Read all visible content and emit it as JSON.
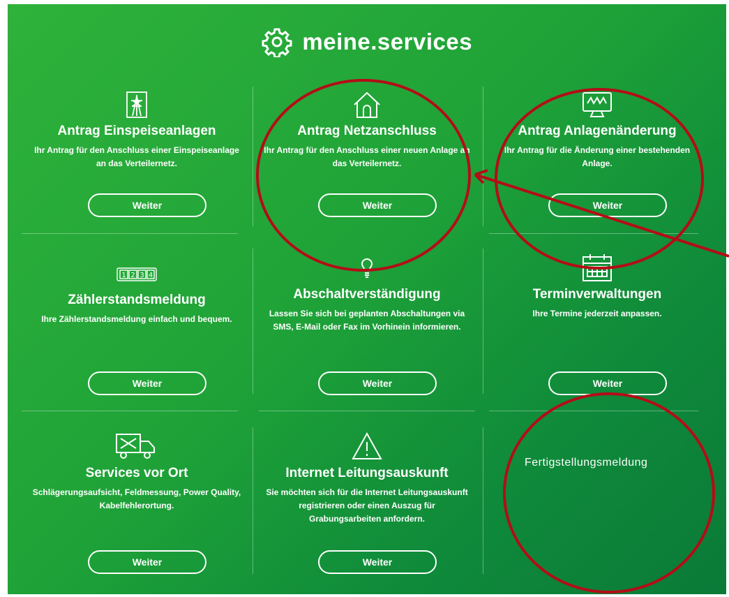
{
  "brand": {
    "title": "meine.services",
    "icon": "gear-icon"
  },
  "colors": {
    "panel": "#1fa338",
    "annotation": "#b30d17",
    "text": "#ffffff"
  },
  "services": [
    {
      "title": "Antrag Einspeiseanlagen",
      "description": "Ihr Antrag für den Anschluss einer Einspeiseanlage an das Verteilernetz.",
      "button": "Weiter",
      "icon": "power-tower-icon"
    },
    {
      "title": "Antrag Netzanschluss",
      "description": "Ihr Antrag für den Anschluss einer neuen Anlage an das Verteilernetz.",
      "button": "Weiter",
      "icon": "house-icon"
    },
    {
      "title": "Antrag Anlagenänderung",
      "description": "Ihr Antrag für die Änderung einer bestehenden Anlage.",
      "button": "Weiter",
      "icon": "monitor-icon"
    },
    {
      "title": "Zählerstandsmeldung",
      "description": "Ihre Zählerstandsmeldung einfach und bequem.",
      "button": "Weiter",
      "icon": "meter-counter-icon"
    },
    {
      "title": "Abschaltverständigung",
      "description": "Lassen Sie sich bei geplanten Abschaltungen via SMS, E-Mail oder Fax im Vorhinein informieren.",
      "button": "Weiter",
      "icon": "lightbulb-icon"
    },
    {
      "title": "Terminverwaltungen",
      "description": "Ihre Termine jederzeit anpassen.",
      "button": "Weiter",
      "icon": "calendar-icon"
    },
    {
      "title": "Services vor Ort",
      "description": "Schlägerungsaufsicht, Feldmessung, Power Quality, Kabelfehlerortung.",
      "button": "Weiter",
      "icon": "service-truck-icon"
    },
    {
      "title": "Internet Leitungsauskunft",
      "description": "Sie möchten sich für die Internet Leitungsauskunft registrieren oder einen Auszug für Grabungsarbeiten anfordern.",
      "button": "Weiter",
      "icon": "warning-triangle-icon"
    }
  ],
  "annotation": {
    "label": "Fertigstellungsmeldung"
  }
}
